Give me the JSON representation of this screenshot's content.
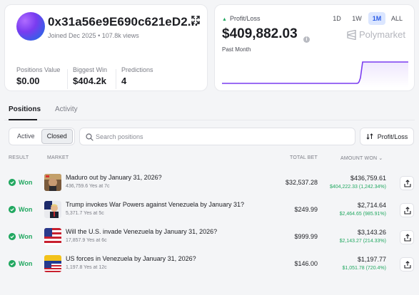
{
  "profile": {
    "username": "0x31a56e9E690c621eD2...",
    "joined": "Joined Dec 2025",
    "views": "107.8k views",
    "stats": [
      {
        "label": "Positions Value",
        "value": "$0.00"
      },
      {
        "label": "Biggest Win",
        "value": "$404.2k"
      },
      {
        "label": "Predictions",
        "value": "4"
      }
    ]
  },
  "pnl": {
    "label": "Profit/Loss",
    "value": "$409,882.03",
    "period": "Past Month",
    "ranges": [
      "1D",
      "1W",
      "1M",
      "ALL"
    ],
    "active_range": "1M",
    "brand": "Polymarket",
    "accent_color": "#7a3cf0"
  },
  "tabs": {
    "positions": "Positions",
    "activity": "Activity"
  },
  "filters": {
    "active": "Active",
    "closed": "Closed",
    "search_placeholder": "Search positions",
    "sort_label": "Profit/Loss"
  },
  "table": {
    "headers": {
      "result": "RESULT",
      "market": "MARKET",
      "total_bet": "TOTAL BET",
      "amount_won": "AMOUNT WON"
    },
    "rows": [
      {
        "result": "Won",
        "title": "Maduro out by January 31, 2026?",
        "sub": "436,759.6 Yes at 7c",
        "bet": "$32,537.28",
        "won": "$436,759.61",
        "won_sub": "$404,222.33 (1,242.34%)"
      },
      {
        "result": "Won",
        "title": "Trump invokes War Powers against Venezuela by January 31?",
        "sub": "5,371.7 Yes at 5c",
        "bet": "$249.99",
        "won": "$2,714.64",
        "won_sub": "$2,464.65 (985.91%)"
      },
      {
        "result": "Won",
        "title": "Will the U.S. invade Venezuela by January 31, 2026?",
        "sub": "17,857.9 Yes at 6c",
        "bet": "$999.99",
        "won": "$3,143.26",
        "won_sub": "$2,143.27 (214.33%)"
      },
      {
        "result": "Won",
        "title": "US forces in Venezuela by January 31, 2026?",
        "sub": "1,197.8 Yes at 12c",
        "bet": "$146.00",
        "won": "$1,197.77",
        "won_sub": "$1,051.78 (720.4%)"
      }
    ]
  },
  "colors": {
    "won_green": "#22a861",
    "active_tab_blue": "#2b5ce6"
  }
}
